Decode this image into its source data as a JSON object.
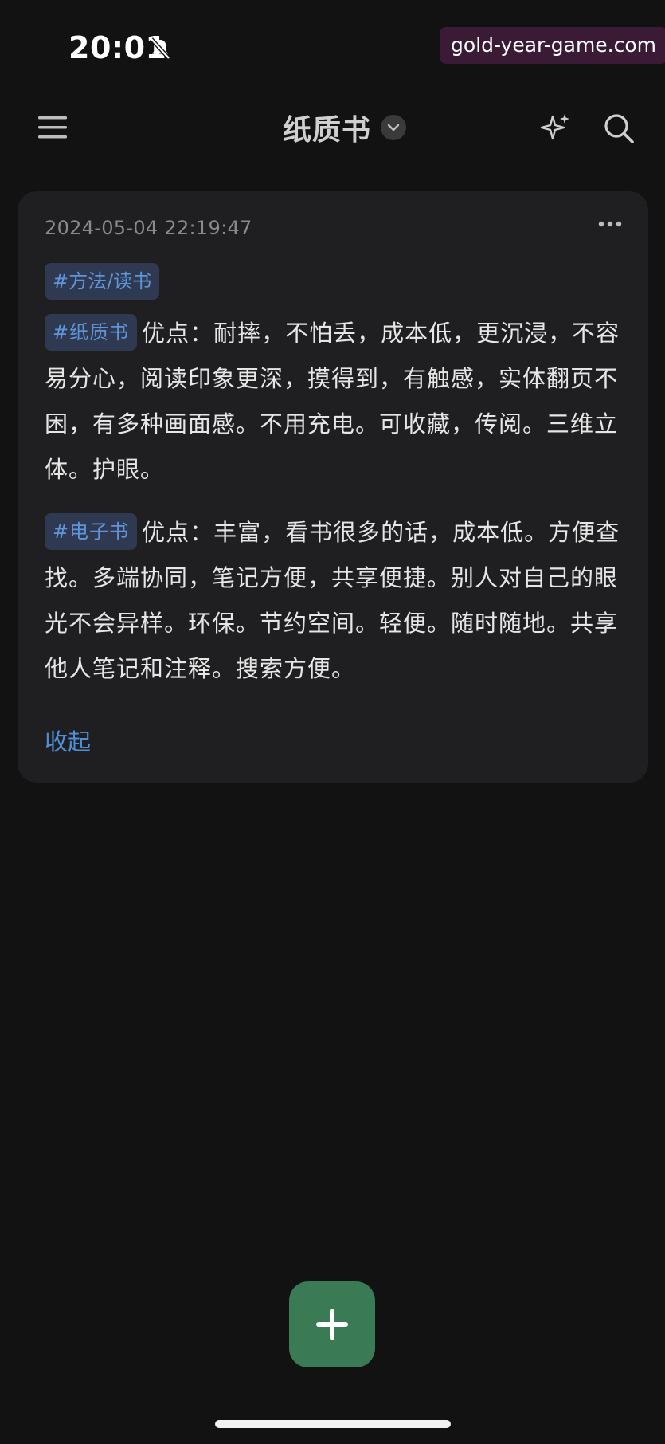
{
  "status_bar": {
    "time": "20:01",
    "watermark": "gold-year-game.com",
    "icons": [
      "bell-muted-icon"
    ]
  },
  "header": {
    "title": "纸质书",
    "icons": [
      "menu-icon",
      "chevron-down-icon",
      "sparkle-icon",
      "search-icon"
    ]
  },
  "memo": {
    "timestamp": "2024-05-04 22:19:47",
    "top_tag": "#方法/读书",
    "paragraphs": [
      {
        "tag": "#纸质书",
        "text": "优点：耐摔，不怕丢，成本低，更沉浸，不容易分心，阅读印象更深，摸得到，有触感，实体翻页不困，有多种画面感。不用充电。可收藏，传阅。三维立体。护眼。"
      },
      {
        "tag": "#电子书",
        "text": "优点：丰富，看书很多的话，成本低。方便查找。多端协同，笔记方便，共享便捷。别人对自己的眼光不会异样。环保。节约空间。轻便。随时随地。共享他人笔记和注释。搜索方便。"
      }
    ],
    "collapse_label": "收起",
    "more_icon": "more-horizontal-icon"
  },
  "fab": {
    "icon": "plus-icon"
  },
  "colors": {
    "background": "#121212",
    "card": "#1f1f21",
    "tag_bg": "#2f3a52",
    "tag_text": "#5f95d8",
    "link": "#4f8fd6",
    "fab": "#3a7b55"
  }
}
